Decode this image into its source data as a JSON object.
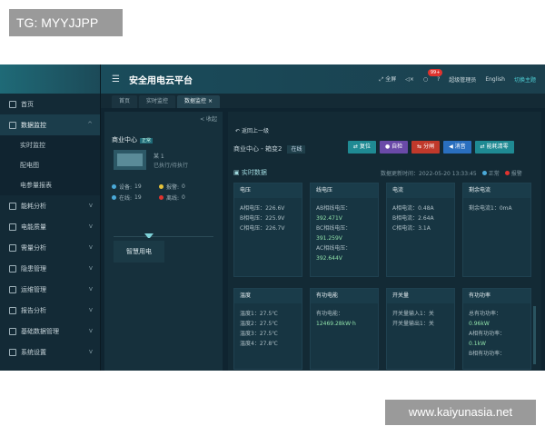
{
  "watermark_tl": "TG: MYYJJPP",
  "watermark_br": "www.kaiyunasia.net",
  "header": {
    "title": "安全用电云平台",
    "fullscreen": "全屏",
    "notify_count": "99+",
    "user": "超级管理员",
    "lang": "English",
    "theme": "切换主题"
  },
  "tabs": [
    {
      "label": "首页"
    },
    {
      "label": "实时监控"
    },
    {
      "label": "数据监控",
      "close": "×"
    }
  ],
  "sidebar": {
    "items": [
      {
        "label": "首页"
      },
      {
        "label": "数据监控",
        "arrow": "^"
      },
      {
        "label": "能耗分析",
        "arrow": "v"
      },
      {
        "label": "电能质量",
        "arrow": "v"
      },
      {
        "label": "需量分析",
        "arrow": "v"
      },
      {
        "label": "隐患管理",
        "arrow": "v"
      },
      {
        "label": "运维管理",
        "arrow": "v"
      },
      {
        "label": "报告分析",
        "arrow": "v"
      },
      {
        "label": "基础数据管理",
        "arrow": "v"
      },
      {
        "label": "系统设置",
        "arrow": "v"
      }
    ],
    "subitems": [
      {
        "label": "实时监控"
      },
      {
        "label": "配电图"
      },
      {
        "label": "电参量报表"
      }
    ]
  },
  "left_panel": {
    "collapse": "< 收起",
    "site": "商业中心",
    "tag": "正常",
    "thumb_t1": "某 1",
    "thumb_t2": "已执行/待执行",
    "stats": [
      {
        "label": "设备:",
        "value": "19",
        "color": "#4aa9d8"
      },
      {
        "label": "报警:",
        "value": "0",
        "color": "#e6c23a"
      },
      {
        "label": "在线:",
        "value": "19",
        "color": "#4aa9d8"
      },
      {
        "label": "离线:",
        "value": "0",
        "color": "#e0332f"
      }
    ],
    "smart_label": "智慧用电"
  },
  "right_panel": {
    "back": "返回上一级",
    "crumb": "商业中心 - 箱变2",
    "status": "在线",
    "buttons": [
      {
        "label": "复位",
        "color": "#1f8a93"
      },
      {
        "label": "自检",
        "color": "#6a4aa8"
      },
      {
        "label": "分闸",
        "color": "#c0392b"
      },
      {
        "label": "消音",
        "color": "#2a6fbf"
      },
      {
        "label": "能耗清零",
        "color": "#1f8a93"
      }
    ],
    "realtime": "实时数据",
    "update_time": "数据更新时间：2022-05-20 13:33:45",
    "normal": "正常",
    "alarm": "报警"
  },
  "cards_row1": [
    {
      "title": "电压",
      "lines": [
        "A相电压：226.6V",
        "B相电压：225.9V",
        "C相电压：226.7V"
      ]
    },
    {
      "title": "线电压",
      "lines": [
        "AB相线电压：",
        "392.471V",
        "BC相线电压：",
        "391.259V",
        "AC相线电压：",
        "392.644V"
      ]
    },
    {
      "title": "电流",
      "lines": [
        "A相电流：0.48A",
        "B相电流：2.64A",
        "C相电流：3.1A"
      ]
    },
    {
      "title": "剩余电流",
      "lines": [
        "剩余电流1：0mA"
      ]
    }
  ],
  "cards_row2": [
    {
      "title": "温度",
      "lines": [
        "温度1：27.5℃",
        "温度2：27.5℃",
        "温度3：27.5℃",
        "温度4：27.8℃"
      ]
    },
    {
      "title": "有功电能",
      "lines": [
        "有功电能：",
        "12469.28kW·h"
      ]
    },
    {
      "title": "开关量",
      "lines": [
        "开关量输入1：关",
        "开关量输出1：关"
      ]
    },
    {
      "title": "有功功率",
      "lines": [
        "总有功功率：",
        "0.96kW",
        "A相有功功率：",
        "0.1kW",
        "B相有功功率："
      ]
    }
  ]
}
